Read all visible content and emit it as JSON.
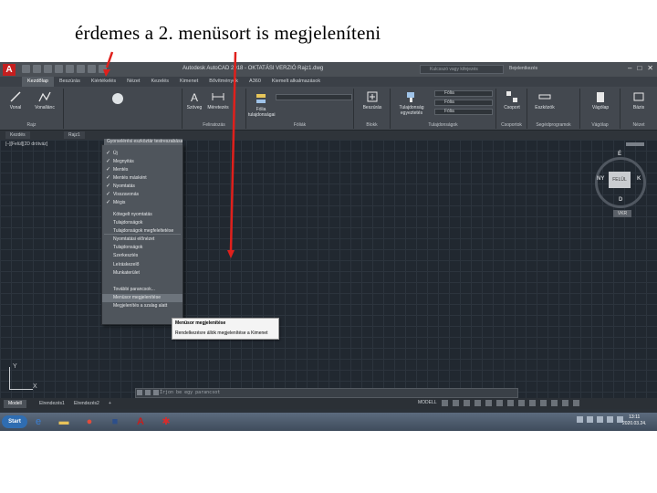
{
  "caption": "érdemes a 2. menüsort is megjeleníteni",
  "titlebar": {
    "app_icon": "A",
    "title": "Autodesk AutoCAD 2018 - OKTATÁSI VERZIÓ     Rajz1.dwg",
    "search_placeholder": "Kulcsszó vagy kifejezés",
    "user": "Bejelentkezés"
  },
  "ribbon_tabs": [
    "Kezdőlap",
    "Beszúrás",
    "Kiértékelés",
    "Nézet",
    "Kezelés",
    "Kimenet",
    "Bővítmények",
    "A360",
    "Kiemelt alkalmazások"
  ],
  "ribbon": {
    "tools": {
      "line": "Vonal",
      "polyline": "Vonallánc",
      "dimension": "Méretezés",
      "text": "Szöveg",
      "layer_props": "Fólia tulajdonságai",
      "insert": "Beszúrás",
      "props_match": "Tulajdonság egyeztetés",
      "group": "Csoport",
      "measure": "Eszközök",
      "clipboard": "Vágólap",
      "base": "Bázis"
    },
    "groups": {
      "draw": "Rajz",
      "annotation": "Feliratozás",
      "layers": "Fóliák",
      "block": "Blokk",
      "properties": "Tulajdonságok",
      "groups": "Csoportok",
      "utilities": "Segédprogramok",
      "clipboard": "Vágólap",
      "view": "Nézet"
    },
    "combo_values": [
      "Fólia",
      "Fólia",
      "Fólia"
    ]
  },
  "file_tabs": [
    "Kezdés",
    "Rajz1"
  ],
  "viewport_label": "[–][Felül][2D drótváz]",
  "viewcube": {
    "face": "FELÜL",
    "north": "É",
    "south": "D",
    "east": "K",
    "west": "NY",
    "wcs": "VKR"
  },
  "ucs": {
    "x": "X",
    "y": "Y"
  },
  "command_line": "Írjon be egy parancsot",
  "layout_tabs": [
    "Modell",
    "Elrendezés1",
    "Elrendezés2"
  ],
  "status": {
    "model": "MODELL"
  },
  "taskbar": {
    "start": "Start",
    "clock_time": "13:11",
    "clock_date": "2020.03.24."
  },
  "menu": {
    "header": "Gyorselérési eszköztár testreszabása",
    "items": [
      {
        "label": "Új",
        "checked": true
      },
      {
        "label": "Megnyitás",
        "checked": true
      },
      {
        "label": "Mentés",
        "checked": true
      },
      {
        "label": "Mentés másként",
        "checked": true
      },
      {
        "label": "Nyomtatás",
        "checked": true
      },
      {
        "label": "Visszavonás",
        "checked": true
      },
      {
        "label": "Mégis",
        "checked": true
      },
      {
        "label": "Kötegelt nyomtatás",
        "checked": false
      },
      {
        "label": "Tulajdonságok",
        "checked": false
      },
      {
        "label": "Tulajdonságok megfeleltetése",
        "checked": false
      },
      {
        "label": "Nyomtatási előnézet",
        "checked": false
      },
      {
        "label": "Tulajdonságok",
        "checked": false
      },
      {
        "label": "Szerkesztés",
        "checked": false
      },
      {
        "label": "Leíráskezelő",
        "checked": false
      },
      {
        "label": "Munkaterület",
        "checked": false
      },
      {
        "label": "További parancsok...",
        "checked": false
      },
      {
        "label": "Menüsor megjelenítése",
        "checked": false
      },
      {
        "label": "Megjelenítés a szalag alatt",
        "checked": false
      }
    ]
  },
  "submenu": {
    "items": [
      "Menüsor megjelenítése",
      "Rendelkezésre állók megjelenítése a Kimenet"
    ]
  }
}
